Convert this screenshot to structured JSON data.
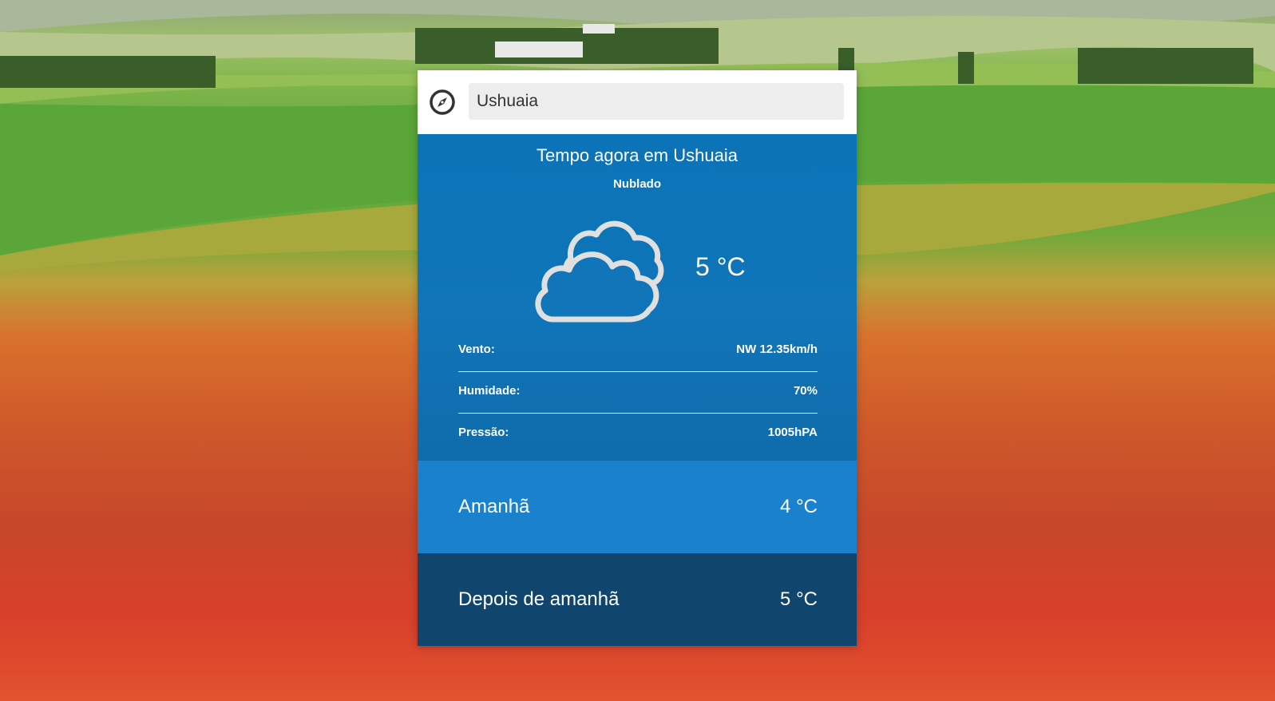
{
  "search": {
    "value": "Ushuaia"
  },
  "current": {
    "title": "Tempo agora em Ushuaia",
    "description": "Nublado",
    "temperature": "5 °C",
    "icon": "cloud-icon",
    "details": [
      {
        "label": "Vento:",
        "value": "NW 12.35km/h"
      },
      {
        "label": "Humidade:",
        "value": "70%"
      },
      {
        "label": "Pressão:",
        "value": "1005hPA"
      }
    ]
  },
  "forecast": [
    {
      "day": "Amanhã",
      "temp": "4 °C",
      "color": "#1a82cc"
    },
    {
      "day": "Depois de amanhã",
      "temp": "5 °C",
      "color": "#10456e"
    }
  ],
  "colors": {
    "current_bg": "#0b73b7",
    "search_bg": "#ffffff",
    "input_bg": "#ededed"
  }
}
